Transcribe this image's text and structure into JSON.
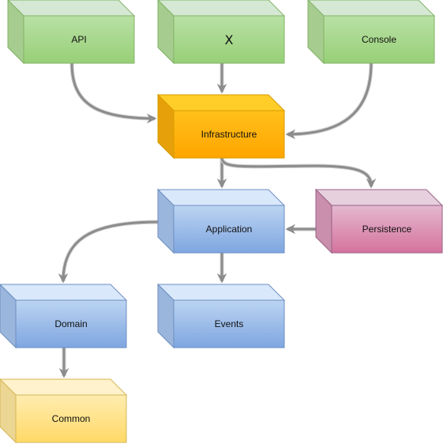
{
  "diagram": {
    "nodes": [
      {
        "id": "api",
        "label": "API",
        "style": "green"
      },
      {
        "id": "x",
        "label": "X",
        "style": "green"
      },
      {
        "id": "console",
        "label": "Console",
        "style": "green"
      },
      {
        "id": "infrastructure",
        "label": "Infrastructure",
        "style": "orange"
      },
      {
        "id": "application",
        "label": "Application",
        "style": "blue"
      },
      {
        "id": "persistence",
        "label": "Persistence",
        "style": "pink"
      },
      {
        "id": "domain",
        "label": "Domain",
        "style": "blue"
      },
      {
        "id": "events",
        "label": "Events",
        "style": "blue"
      },
      {
        "id": "common",
        "label": "Common",
        "style": "yellow"
      }
    ],
    "edges": [
      {
        "from": "api",
        "to": "infrastructure"
      },
      {
        "from": "x",
        "to": "infrastructure"
      },
      {
        "from": "console",
        "to": "infrastructure"
      },
      {
        "from": "infrastructure",
        "to": "application"
      },
      {
        "from": "infrastructure",
        "to": "persistence"
      },
      {
        "from": "persistence",
        "to": "application"
      },
      {
        "from": "application",
        "to": "domain"
      },
      {
        "from": "application",
        "to": "events"
      },
      {
        "from": "domain",
        "to": "common"
      }
    ],
    "styles": {
      "green": {
        "top": "#d5e8d4",
        "front": "#b9e0a5",
        "front2": "#97d077",
        "side": "#a6cc8f",
        "stroke": "#82b366"
      },
      "orange": {
        "top": "#ffcd28",
        "front": "#ffc01a",
        "front2": "#ffa500",
        "side": "#e6a00a",
        "stroke": "#d79b00"
      },
      "blue": {
        "top": "#dae8fc",
        "front": "#bcd4f2",
        "front2": "#7ea6e0",
        "side": "#9bb6dc",
        "stroke": "#6c8ebf"
      },
      "pink": {
        "top": "#e6d0de",
        "front": "#e4b8d0",
        "front2": "#d5739d",
        "side": "#c98fac",
        "stroke": "#996185"
      },
      "yellow": {
        "top": "#fff2cc",
        "front": "#ffecb0",
        "front2": "#ffd966",
        "side": "#ecd693",
        "stroke": "#d6b656"
      }
    },
    "connector_color": "#8c8c8c"
  }
}
